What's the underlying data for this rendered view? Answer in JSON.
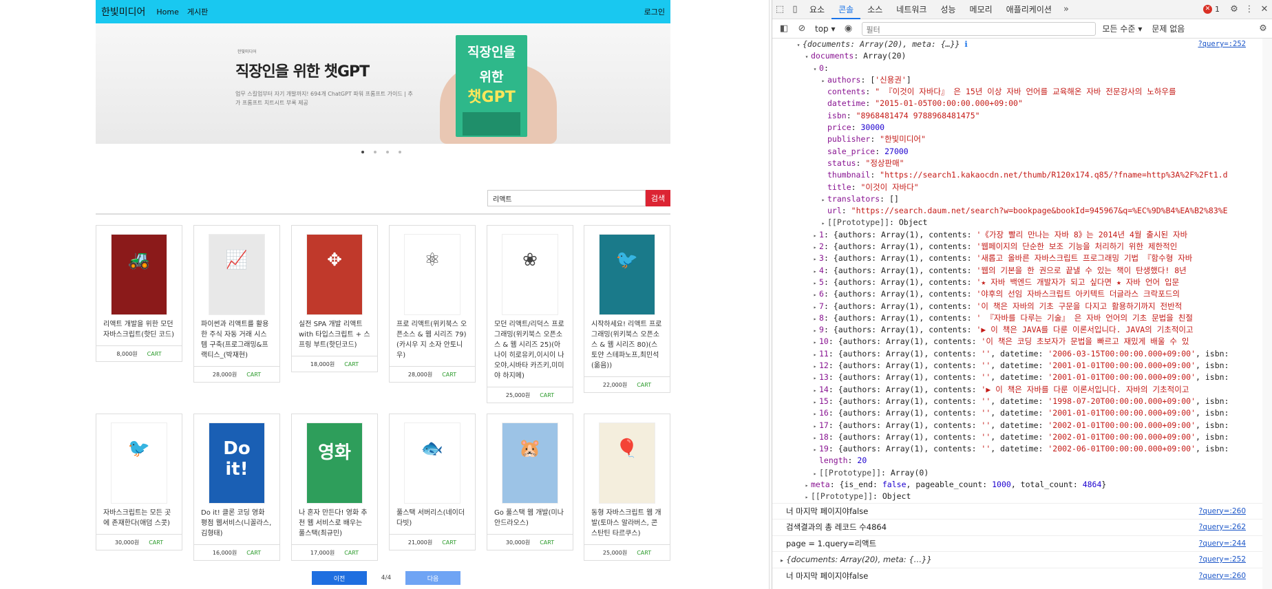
{
  "nav": {
    "brand": "한빛미디어",
    "home": "Home",
    "board": "게시판",
    "login": "로그인"
  },
  "banner": {
    "publisher": "한빛미디어",
    "title": "직장인을 위한 챗GPT",
    "desc": "업무 스킬업부터 자기 개발까지! 694개 ChatGPT 파워 프롬프트 가이드 | 추가 프롬프트 치트시트 부록 제공",
    "book_line1": "직장인을",
    "book_line2": "위한",
    "book_line3": "챗GPT"
  },
  "search": {
    "value": "리액트",
    "button": "검색"
  },
  "books": [
    {
      "title": "리액트 개발을 위한 모던 자바스크립트(핫딘 코드)",
      "price": "8,000원",
      "cart": "CART",
      "cover_color": "#8b1a1a",
      "glyph": "🚜"
    },
    {
      "title": "파이썬과 리액트를 활용한 주식 자동 거래 시스템 구축(프로그래밍&프랙티스_(박재현)",
      "price": "28,000원",
      "cart": "CART",
      "cover_color": "#e8e8e8",
      "glyph": "📈"
    },
    {
      "title": "실전 SPA 개발 리액트 with 타입스크립트 + 스프링 부트(핫딘코드)",
      "price": "18,000원",
      "cart": "CART",
      "cover_color": "#c0392b",
      "glyph": "✥"
    },
    {
      "title": "프로 리액트(위키북스 오픈소스 & 웹 시리즈 79)(카시우 지 소자 안토니우)",
      "price": "28,000원",
      "cart": "CART",
      "cover_color": "#ffffff",
      "glyph": "⚛"
    },
    {
      "title": "모던 리액트/리덕스 프로그래밍(위키북스 오픈소스 & 웹 시리즈 25)(아나이 히로유키,이시이 나오야,시바타 카즈키,미미야 하지메)",
      "price": "25,000원",
      "cart": "CART",
      "cover_color": "#ffffff",
      "glyph": "❀"
    },
    {
      "title": "시작하세요! 리액트 프로그래밍(위키북스 오픈소스 & 웹 시리즈 80)(스토얀 스테파노프,최민석 (옮음))",
      "price": "22,000원",
      "cart": "CART",
      "cover_color": "#1a7a8a",
      "glyph": "🐦"
    },
    {
      "title": "자바스크립트는 모든 곳에 존재한다(애덤 스콧)",
      "price": "30,000원",
      "cart": "CART",
      "cover_color": "#ffffff",
      "glyph": "🐦"
    },
    {
      "title": "Do it! 클론 코딩 영화 평점 웹서비스(니꼴라스,김형태)",
      "price": "16,000원",
      "cart": "CART",
      "cover_color": "#1a5fb4",
      "glyph": "Do it!"
    },
    {
      "title": "나 혼자 만든다! 영화 추천 웹 서비스로 배우는 풀스택(최규민)",
      "price": "17,000원",
      "cart": "CART",
      "cover_color": "#2e9e5b",
      "glyph": "영화"
    },
    {
      "title": "풀스택 서버리스(네이더 다빗)",
      "price": "21,000원",
      "cart": "CART",
      "cover_color": "#ffffff",
      "glyph": "🐟"
    },
    {
      "title": "Go 풀스택 웹 개발(미나 안드라오스)",
      "price": "30,000원",
      "cart": "CART",
      "cover_color": "#9cc3e6",
      "glyph": "🐹"
    },
    {
      "title": "동형 자바스크립트 웹 개발(토마스 알라버스, 콘스탄틴 타르쿠스)",
      "price": "25,000원",
      "cart": "CART",
      "cover_color": "#f4eedd",
      "glyph": "🎈"
    }
  ],
  "pager": {
    "prev": "이전",
    "page": "4/4",
    "next": "다음"
  },
  "devtools": {
    "tabs": [
      "요소",
      "콘솔",
      "소스",
      "네트워크",
      "성능",
      "메모리",
      "애플리케이션"
    ],
    "active_tab": "콘솔",
    "error_count": "1",
    "context": "top",
    "filter_placeholder": "필터",
    "level": "모든 수준",
    "issues": "문제 없음"
  },
  "console": [
    {
      "type": "obj",
      "indent": 0,
      "tri": "▾",
      "html": "<span class='it'>{documents: Array(20), meta: {…}}</span> <span style='color:#1a73e8'>ℹ</span>",
      "src": "?query=:252"
    },
    {
      "type": "obj",
      "indent": 1,
      "tri": "▾",
      "html": "<span class='k'>documents</span>: Array(20)"
    },
    {
      "type": "obj",
      "indent": 2,
      "tri": "▾",
      "html": "<span class='k'>0</span>:"
    },
    {
      "type": "obj",
      "indent": 3,
      "tri": "▸",
      "html": "<span class='k'>authors</span>: [<span class='s'>'신용권'</span>]"
    },
    {
      "type": "obj",
      "indent": 3,
      "tri": "",
      "html": "<span class='k'>contents</span>: <span class='s'>\" 『이것이 자바다』 은 15년 이상 자바 언어를 교육해온 자바 전문강사의 노하우를</span>"
    },
    {
      "type": "obj",
      "indent": 3,
      "tri": "",
      "html": "<span class='k'>datetime</span>: <span class='s'>\"2015-01-05T00:00:00.000+09:00\"</span>"
    },
    {
      "type": "obj",
      "indent": 3,
      "tri": "",
      "html": "<span class='k'>isbn</span>: <span class='s'>\"8968481474 9788968481475\"</span>"
    },
    {
      "type": "obj",
      "indent": 3,
      "tri": "",
      "html": "<span class='k'>price</span>: <span class='n'>30000</span>"
    },
    {
      "type": "obj",
      "indent": 3,
      "tri": "",
      "html": "<span class='k'>publisher</span>: <span class='s'>\"한빛미디어\"</span>"
    },
    {
      "type": "obj",
      "indent": 3,
      "tri": "",
      "html": "<span class='k'>sale_price</span>: <span class='n'>27000</span>"
    },
    {
      "type": "obj",
      "indent": 3,
      "tri": "",
      "html": "<span class='k'>status</span>: <span class='s'>\"정상판매\"</span>"
    },
    {
      "type": "obj",
      "indent": 3,
      "tri": "",
      "html": "<span class='k'>thumbnail</span>: <span class='s'>\"https://search1.kakaocdn.net/thumb/R120x174.q85/?fname=http%3A%2F%2Ft1.d</span>"
    },
    {
      "type": "obj",
      "indent": 3,
      "tri": "",
      "html": "<span class='k'>title</span>: <span class='s'>\"이것이 자바다\"</span>"
    },
    {
      "type": "obj",
      "indent": 3,
      "tri": "▸",
      "html": "<span class='k'>translators</span>: []"
    },
    {
      "type": "obj",
      "indent": 3,
      "tri": "",
      "html": "<span class='k'>url</span>: <span class='s'>\"https://search.daum.net/search?w=bookpage&bookId=945967&q=%EC%9D%B4%EA%B2%83%E</span>"
    },
    {
      "type": "obj",
      "indent": 3,
      "tri": "▸",
      "html": "<span class='g'>[[Prototype]]</span>: Object"
    },
    {
      "type": "obj",
      "indent": 2,
      "tri": "▸",
      "html": "<span class='k'>1</span>: {authors: Array(1), contents: <span class='s'>'《가장 빨리 만나는 자바 8》는 2014년 4월 출시된 자바 </span>"
    },
    {
      "type": "obj",
      "indent": 2,
      "tri": "▸",
      "html": "<span class='k'>2</span>: {authors: Array(1), contents: <span class='s'>'웹페이지의 단순한 보조 기능을 처리하기 위한 제한적인 </span>"
    },
    {
      "type": "obj",
      "indent": 2,
      "tri": "▸",
      "html": "<span class='k'>3</span>: {authors: Array(1), contents: <span class='s'>'새롭고 올바른 자바스크립트 프로그래밍 기법 『함수형 자바</span>"
    },
    {
      "type": "obj",
      "indent": 2,
      "tri": "▸",
      "html": "<span class='k'>4</span>: {authors: Array(1), contents: <span class='s'>'웹의 기본을 한 권으로 끝낼 수 있는 책이 탄생했다! 8년</span>"
    },
    {
      "type": "obj",
      "indent": 2,
      "tri": "▸",
      "html": "<span class='k'>5</span>: {authors: Array(1), contents: <span class='s'>'★ 자바 백엔드 개발자가 되고 싶다면 ★ 자바 언어 입문</span>"
    },
    {
      "type": "obj",
      "indent": 2,
      "tri": "▸",
      "html": "<span class='k'>6</span>: {authors: Array(1), contents: <span class='s'>'야후의 선임 자바스크립트 아키텍트 더글라스 크락포드의 </span>"
    },
    {
      "type": "obj",
      "indent": 2,
      "tri": "▸",
      "html": "<span class='k'>7</span>: {authors: Array(1), contents: <span class='s'>'이 책은 자바의 기초 구문을 다지고 활용하기까지 전반적</span>"
    },
    {
      "type": "obj",
      "indent": 2,
      "tri": "▸",
      "html": "<span class='k'>8</span>: {authors: Array(1), contents: <span class='s'>' 『자바를 다루는 기술』 은 자바 언어의 기초 문법을 친절</span>"
    },
    {
      "type": "obj",
      "indent": 2,
      "tri": "▸",
      "html": "<span class='k'>9</span>: {authors: Array(1), contents: <span class='s'>'▶ 이 책은 JAVA를 다룬 이론서입니다. JAVA의 기초적이고</span>"
    },
    {
      "type": "obj",
      "indent": 2,
      "tri": "▸",
      "html": "<span class='k'>10</span>: {authors: Array(1), contents: <span class='s'>'이 책은 코딩 초보자가 문법을 빠르고 재밌게 배울 수 있</span>"
    },
    {
      "type": "obj",
      "indent": 2,
      "tri": "▸",
      "html": "<span class='k'>11</span>: {authors: Array(1), contents: <span class='s'>''</span>, datetime: <span class='s'>'2006-03-15T00:00:00.000+09:00'</span>, isbn:"
    },
    {
      "type": "obj",
      "indent": 2,
      "tri": "▸",
      "html": "<span class='k'>12</span>: {authors: Array(1), contents: <span class='s'>''</span>, datetime: <span class='s'>'2001-01-01T00:00:00.000+09:00'</span>, isbn:"
    },
    {
      "type": "obj",
      "indent": 2,
      "tri": "▸",
      "html": "<span class='k'>13</span>: {authors: Array(1), contents: <span class='s'>''</span>, datetime: <span class='s'>'2001-01-01T00:00:00.000+09:00'</span>, isbn:"
    },
    {
      "type": "obj",
      "indent": 2,
      "tri": "▸",
      "html": "<span class='k'>14</span>: {authors: Array(1), contents: <span class='s'>'▶ 이 책은 자바를 다룬 이론서입니다. 자바의 기초적이고</span>"
    },
    {
      "type": "obj",
      "indent": 2,
      "tri": "▸",
      "html": "<span class='k'>15</span>: {authors: Array(1), contents: <span class='s'>''</span>, datetime: <span class='s'>'1998-07-20T00:00:00.000+09:00'</span>, isbn:"
    },
    {
      "type": "obj",
      "indent": 2,
      "tri": "▸",
      "html": "<span class='k'>16</span>: {authors: Array(1), contents: <span class='s'>''</span>, datetime: <span class='s'>'2001-01-01T00:00:00.000+09:00'</span>, isbn:"
    },
    {
      "type": "obj",
      "indent": 2,
      "tri": "▸",
      "html": "<span class='k'>17</span>: {authors: Array(1), contents: <span class='s'>''</span>, datetime: <span class='s'>'2002-01-01T00:00:00.000+09:00'</span>, isbn:"
    },
    {
      "type": "obj",
      "indent": 2,
      "tri": "▸",
      "html": "<span class='k'>18</span>: {authors: Array(1), contents: <span class='s'>''</span>, datetime: <span class='s'>'2002-01-01T00:00:00.000+09:00'</span>, isbn:"
    },
    {
      "type": "obj",
      "indent": 2,
      "tri": "▸",
      "html": "<span class='k'>19</span>: {authors: Array(1), contents: <span class='s'>''</span>, datetime: <span class='s'>'2002-06-01T00:00:00.000+09:00'</span>, isbn:"
    },
    {
      "type": "obj",
      "indent": 2,
      "tri": "",
      "html": "<span class='k'>length</span>: <span class='n'>20</span>"
    },
    {
      "type": "obj",
      "indent": 2,
      "tri": "▸",
      "html": "<span class='g'>[[Prototype]]</span>: Array(0)"
    },
    {
      "type": "obj",
      "indent": 1,
      "tri": "▸",
      "html": "<span class='k'>meta</span>: {is_end: <span class='n'>false</span>, pageable_count: <span class='n'>1000</span>, total_count: <span class='n'>4864</span>}"
    },
    {
      "type": "obj",
      "indent": 1,
      "tri": "▸",
      "html": "<span class='g'>[[Prototype]]</span>: Object"
    },
    {
      "type": "log",
      "indent": 0,
      "tri": "",
      "html": "너 마지막 페이지야false",
      "src": "?query=:260"
    },
    {
      "type": "log",
      "indent": 0,
      "tri": "",
      "html": "검색결과의 총 레코드 수4864",
      "src": "?query=:262"
    },
    {
      "type": "log",
      "indent": 0,
      "tri": "",
      "html": "page = 1.query=리액트",
      "src": "?query=:244"
    },
    {
      "type": "log",
      "indent": 0,
      "tri": "▸",
      "html": "<span class='it'>{documents: Array(20), meta: {…}}</span>",
      "src": "?query=:252"
    },
    {
      "type": "log",
      "indent": 0,
      "tri": "",
      "html": "너 마지막 페이지야false",
      "src": "?query=:260"
    }
  ]
}
